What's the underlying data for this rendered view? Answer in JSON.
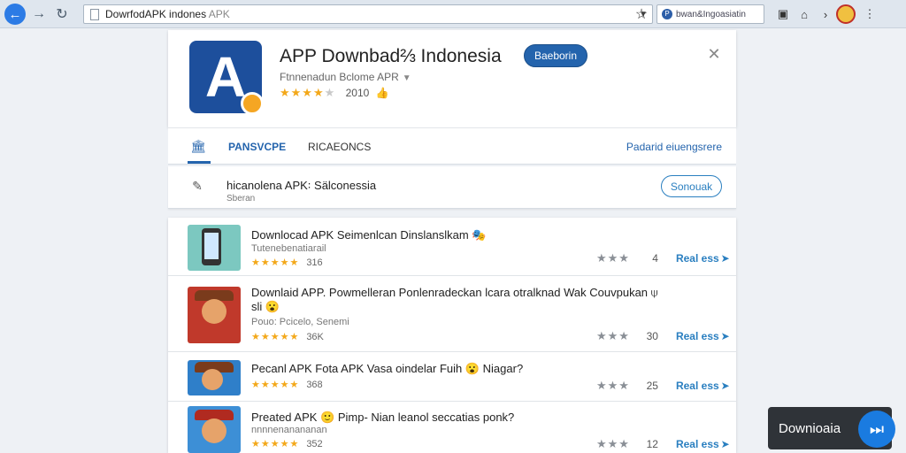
{
  "browser": {
    "url": "DowrfodAPK indones ",
    "url_suffix": "APK",
    "search_text": "bwan&Ingoasiatin",
    "icons": [
      "back-icon",
      "forward-icon",
      "reload-icon",
      "page-icon",
      "star-icon",
      "pocket-icon",
      "home-icon",
      "menu-icon"
    ]
  },
  "app": {
    "title": "APP Downbad⅔ Indonesia",
    "subtitle": "Ftnnenadun Bclome APR",
    "rating_year": "2010",
    "primary_button": "Baeborin",
    "colors": {
      "accent": "#2464ad",
      "star": "#f3a81a"
    }
  },
  "tabs": {
    "items": [
      "PANSVCPE",
      "RICAEONCS"
    ],
    "right_link": "Padarid eiuengsrere"
  },
  "search_result": {
    "title": "hicanolena APK꞉ Sälconessia",
    "sub": "Sberan",
    "button": "Sonouak"
  },
  "list": {
    "items": [
      {
        "title": "Downlocad APK Seimenlcan Dinslanslkam 🎭",
        "sub": "Tutenebenatiarail",
        "count": "316",
        "right_num": "4",
        "link": "Real ess"
      },
      {
        "title": "Downlaid APP. Powmelleran Ponlenradeckan lcara otralknad Wak Couvpukan ⍦",
        "title2": "sli 😮",
        "sub": "Pouo: Pcicelo, Senemi",
        "count": "36K",
        "right_num": "30",
        "link": "Real ess"
      },
      {
        "title": "Pecanl APK Fota APK Vasa oindelar Fuih 😮 Niagar?",
        "count": "368",
        "right_num": "25",
        "link": "Real ess"
      },
      {
        "title": "Preated APK 🙂 Pimp- Nian leanol seccatias ponk?",
        "sub": "nnnnenanananan",
        "count": "352",
        "right_num": "12",
        "link": "Real ess"
      }
    ]
  },
  "floating": {
    "label": "Downioaia"
  }
}
